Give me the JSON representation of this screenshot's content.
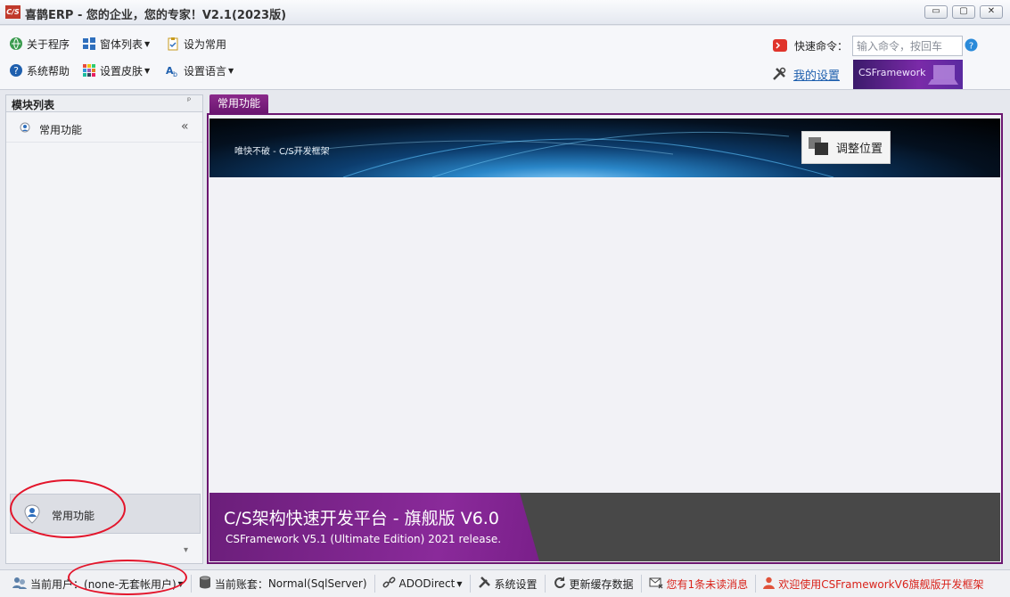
{
  "window": {
    "logo_text": "C/S",
    "title": "喜鹊ERP - 您的企业，您的专家！V2.1(2023版)",
    "controls": [
      "▭",
      "▢",
      "✕"
    ]
  },
  "toolbar": {
    "about": "关于程序",
    "window_list": "窗体列表",
    "set_common": "设为常用",
    "help": "系统帮助",
    "skin": "设置皮肤",
    "language": "设置语言",
    "quick_cmd_label": "快速命令：",
    "quick_cmd_placeholder": "输入命令，按回车",
    "my_settings": "我的设置",
    "banner_text": "CSFramework"
  },
  "sidebar": {
    "header": "模块列表",
    "pin": "ᵖ",
    "items": [
      {
        "label": "常用功能",
        "collapse": "«"
      }
    ],
    "bottom_item": "常用功能",
    "more_arrow": "▾"
  },
  "main": {
    "tab": "常用功能",
    "hero_slogan": "唯快不破 - C/S开发框架",
    "adjust_button": "调整位置",
    "footer_title": "C/S架构快速开发平台 - 旗舰版 V6.0",
    "footer_sub": "CSFramework V5.1 (Ultimate Edition) 2021 release."
  },
  "status": {
    "current_user_label": "当前用户：",
    "current_user_value": "(none-无套帐用户)",
    "current_account_label": "当前账套：",
    "current_account_value": "Normal(SqlServer)",
    "ado": "ADODirect",
    "sys_settings": "系统设置",
    "refresh_cache": "更新缓存数据",
    "unread": "您有1条未读消息",
    "welcome": "欢迎使用CSFrameworkV6旗舰版开发框架"
  },
  "colors": {
    "accent": "#6b1670",
    "alert": "#d9231b",
    "annotation": "#e3152b"
  }
}
